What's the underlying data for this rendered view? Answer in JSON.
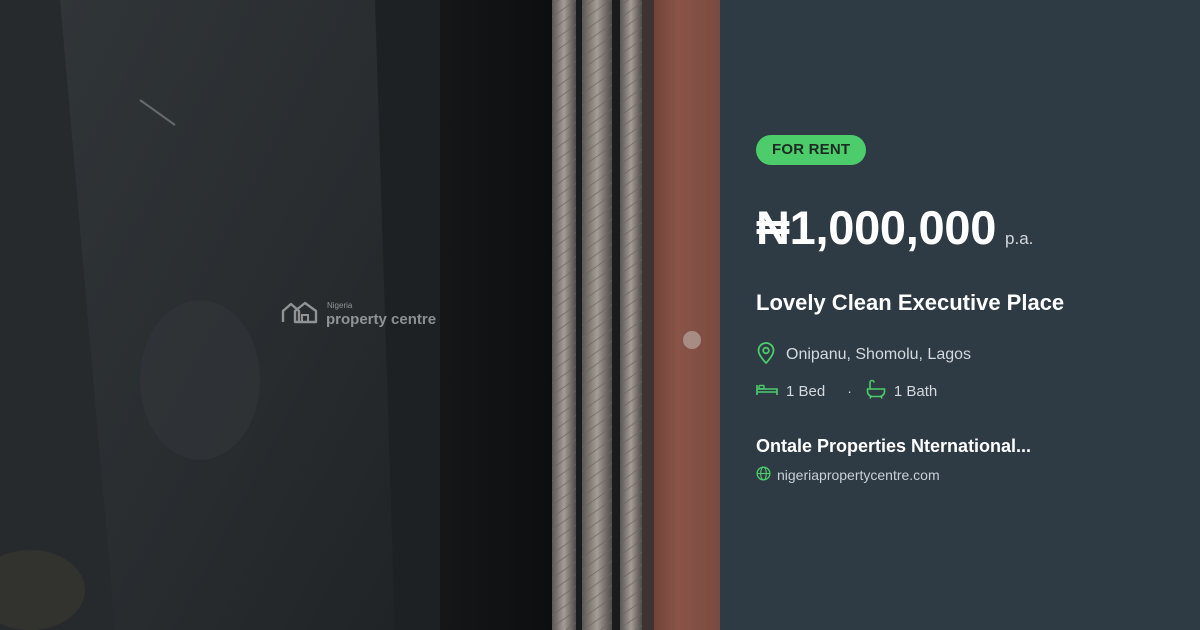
{
  "listing": {
    "badge": "FOR RENT",
    "price": "₦1,000,000",
    "period": "p.a.",
    "title": "Lovely Clean Executive Place",
    "location": "Onipanu, Shomolu, Lagos",
    "beds": "1 Bed",
    "baths": "1 Bath",
    "separator": "·"
  },
  "agent": {
    "name": "Ontale Properties Nternational...",
    "website": "nigeriapropertycentre.com"
  },
  "watermark": {
    "small": "Nigeria",
    "big": "property centre"
  },
  "colors": {
    "panel_bg": "#2e3a44",
    "accent_green": "#4ccc6a",
    "text_white": "#ffffff",
    "text_muted": "#d3d9de"
  },
  "icons": {
    "location": "map-pin-icon",
    "beds": "bed-icon",
    "baths": "bathtub-icon",
    "website": "globe-icon",
    "watermark": "house-logo-icon"
  }
}
